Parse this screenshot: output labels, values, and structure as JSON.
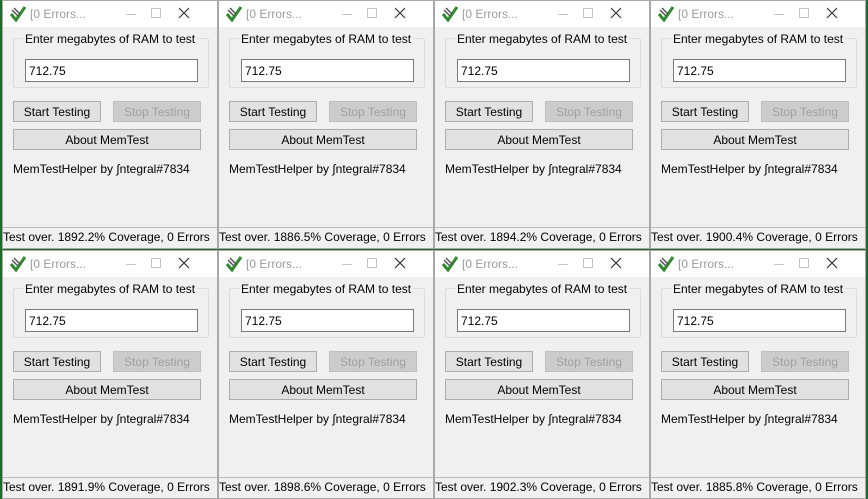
{
  "windows": [
    {
      "title": "[0 Errors...",
      "prompt_label": "Enter megabytes of RAM to test",
      "ram_value": "712.75",
      "start_label": "Start Testing",
      "stop_label": "Stop Testing",
      "about_label": "About MemTest",
      "credit": "MemTestHelper by ∫ntegral#7834",
      "status": "Test over. 1892.2% Coverage, 0 Errors"
    },
    {
      "title": "[0 Errors...",
      "prompt_label": "Enter megabytes of RAM to test",
      "ram_value": "712.75",
      "start_label": "Start Testing",
      "stop_label": "Stop Testing",
      "about_label": "About MemTest",
      "credit": "MemTestHelper by ∫ntegral#7834",
      "status": "Test over. 1886.5% Coverage, 0 Errors"
    },
    {
      "title": "[0 Errors...",
      "prompt_label": "Enter megabytes of RAM to test",
      "ram_value": "712.75",
      "start_label": "Start Testing",
      "stop_label": "Stop Testing",
      "about_label": "About MemTest",
      "credit": "MemTestHelper by ∫ntegral#7834",
      "status": "Test over. 1894.2% Coverage, 0 Errors"
    },
    {
      "title": "[0 Errors...",
      "prompt_label": "Enter megabytes of RAM to test",
      "ram_value": "712.75",
      "start_label": "Start Testing",
      "stop_label": "Stop Testing",
      "about_label": "About MemTest",
      "credit": "MemTestHelper by ∫ntegral#7834",
      "status": "Test over. 1900.4% Coverage, 0 Errors"
    },
    {
      "title": "[0 Errors...",
      "prompt_label": "Enter megabytes of RAM to test",
      "ram_value": "712.75",
      "start_label": "Start Testing",
      "stop_label": "Stop Testing",
      "about_label": "About MemTest",
      "credit": "MemTestHelper by ∫ntegral#7834",
      "status": "Test over. 1891.9% Coverage, 0 Errors"
    },
    {
      "title": "[0 Errors...",
      "prompt_label": "Enter megabytes of RAM to test",
      "ram_value": "712.75",
      "start_label": "Start Testing",
      "stop_label": "Stop Testing",
      "about_label": "About MemTest",
      "credit": "MemTestHelper by ∫ntegral#7834",
      "status": "Test over. 1898.6% Coverage, 0 Errors"
    },
    {
      "title": "[0 Errors...",
      "prompt_label": "Enter megabytes of RAM to test",
      "ram_value": "712.75",
      "start_label": "Start Testing",
      "stop_label": "Stop Testing",
      "about_label": "About MemTest",
      "credit": "MemTestHelper by ∫ntegral#7834",
      "status": "Test over. 1902.3% Coverage, 0 Errors"
    },
    {
      "title": "[0 Errors...",
      "prompt_label": "Enter megabytes of RAM to test",
      "ram_value": "712.75",
      "start_label": "Start Testing",
      "stop_label": "Stop Testing",
      "about_label": "About MemTest",
      "credit": "MemTestHelper by ∫ntegral#7834",
      "status": "Test over. 1885.8% Coverage, 0 Errors"
    }
  ],
  "icons": {
    "app": "memtest-check-icon",
    "minimize": "minimize-icon",
    "maximize": "maximize-icon",
    "close": "close-icon"
  },
  "colors": {
    "desktop": "#1f6b2a",
    "window_bg": "#f0f0f0",
    "icon_green": "#2e8b2e",
    "disabled_text": "#a0a0a0"
  }
}
